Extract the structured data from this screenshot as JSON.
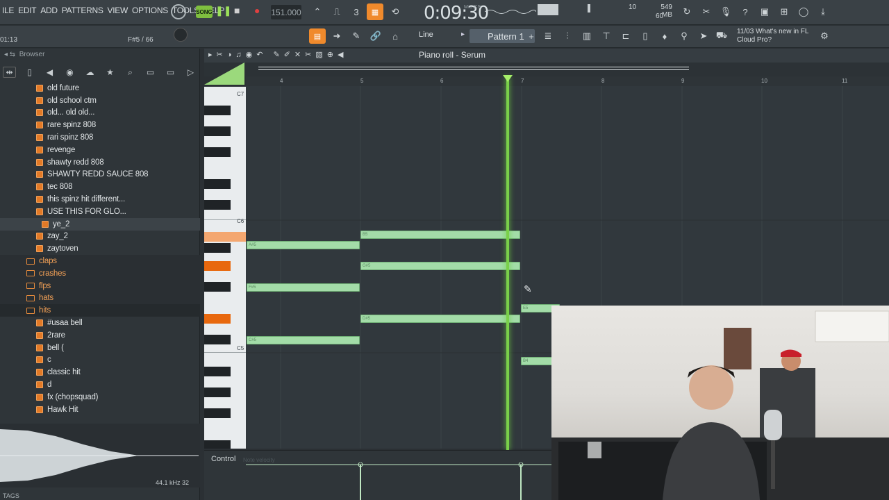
{
  "menu": [
    "ILE",
    "EDIT",
    "ADD",
    "PATTERNS",
    "VIEW",
    "OPTIONS",
    "TOOLS",
    "HELP"
  ],
  "transport": {
    "song_label": "SONG",
    "tempo": "151.000",
    "time": "0:09:30",
    "time_unit": "M:S:CS",
    "cpu_value": "10",
    "memory": "549 MB",
    "polyphony": "60"
  },
  "hint": {
    "left": "01:13",
    "note": "F#5 / 66"
  },
  "snap": "Line",
  "pattern": "Pattern 1",
  "news": {
    "date": "11/03",
    "line1": "What's new in FL",
    "line2": "Cloud Pro?"
  },
  "browser": {
    "title": "Browser",
    "items": [
      {
        "label": "old future",
        "type": "file"
      },
      {
        "label": "old school ctm",
        "type": "file"
      },
      {
        "label": "old... old old...",
        "type": "file"
      },
      {
        "label": "rare spinz 808",
        "type": "file"
      },
      {
        "label": "rari spinz 808",
        "type": "file"
      },
      {
        "label": "revenge",
        "type": "file"
      },
      {
        "label": "shawty redd 808",
        "type": "file"
      },
      {
        "label": "SHAWTY REDD SAUCE 808",
        "type": "file"
      },
      {
        "label": "tec 808",
        "type": "file"
      },
      {
        "label": "this spinz hit different...",
        "type": "file"
      },
      {
        "label": "USE THIS FOR GLO...",
        "type": "file"
      },
      {
        "label": "ye_2",
        "type": "file-selected"
      },
      {
        "label": "zay_2",
        "type": "file"
      },
      {
        "label": "zaytoven",
        "type": "file"
      },
      {
        "label": "claps",
        "type": "folder"
      },
      {
        "label": "crashes",
        "type": "folder"
      },
      {
        "label": "flps",
        "type": "folder"
      },
      {
        "label": "hats",
        "type": "folder"
      },
      {
        "label": "hits",
        "type": "folder"
      },
      {
        "label": "#usaa bell",
        "type": "file"
      },
      {
        "label": "2rare",
        "type": "file"
      },
      {
        "label": "bell (",
        "type": "file"
      },
      {
        "label": "c",
        "type": "file"
      },
      {
        "label": "classic hit",
        "type": "file"
      },
      {
        "label": "d",
        "type": "file"
      },
      {
        "label": "fx (chopsquad)",
        "type": "file"
      },
      {
        "label": "Hawk Hit",
        "type": "file"
      }
    ],
    "wave_info": "44.1 kHz 32",
    "tags": "TAGS"
  },
  "piano_roll": {
    "title": "Piano roll - Serum",
    "bars": [
      "4",
      "5",
      "6",
      "7",
      "8",
      "9",
      "10",
      "11"
    ],
    "octaves": [
      "C7",
      "C6",
      "C5"
    ],
    "notes": [
      {
        "label": "B5"
      },
      {
        "label": "A#5"
      },
      {
        "label": "G#5"
      },
      {
        "label": "F#5"
      },
      {
        "label": "E5"
      },
      {
        "label": "D#5"
      },
      {
        "label": "C#5"
      },
      {
        "label": "B4"
      }
    ],
    "control_label": "Control",
    "control_target": "Note velocity"
  },
  "colors": {
    "accent": "#e37a27",
    "note": "#a3dca8",
    "playhead": "#7ad04a"
  }
}
